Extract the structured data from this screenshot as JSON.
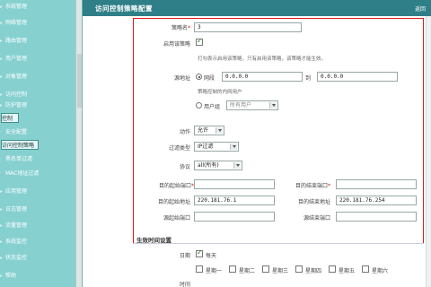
{
  "header": {
    "title": "访问控制策略配置",
    "back": "返回"
  },
  "sidebar": {
    "items": [
      {
        "label": "系统管理"
      },
      {
        "label": "网络管理"
      },
      {
        "label": "路由管理"
      },
      {
        "label": "用户管理"
      },
      {
        "label": "对象管理"
      },
      {
        "label": "访问控制"
      },
      {
        "label": "防护管理"
      },
      {
        "label": "控制"
      },
      {
        "label": "安全配置"
      },
      {
        "label": "访问控制策略"
      },
      {
        "label": "黑名单过滤"
      },
      {
        "label": "MAC地址过滤"
      },
      {
        "label": "应用管理"
      },
      {
        "label": "日志管理"
      },
      {
        "label": "流量管理"
      },
      {
        "label": "系统监控"
      },
      {
        "label": "状态监控"
      },
      {
        "label": "帮助"
      }
    ]
  },
  "form": {
    "policy_name_label": "策略名",
    "policy_name_value": "3",
    "enable_label": "启用该策略",
    "enable_hint": "打勾表示启用该策略，只有启用该策略，该策略才能生效。",
    "src_addr_label": "源地址",
    "src_range_label": "网段",
    "src_start": "0.0.0.0",
    "src_to": "到",
    "src_end": "0.0.0.0",
    "src_hint": "策略控制的内网用户",
    "user_group_label": "用户组",
    "user_group_value": "所有用户",
    "action_label": "动作",
    "action_value": "允许",
    "filter_type_label": "过滤类型",
    "filter_type_value": "IP过滤",
    "protocol_label": "协议",
    "protocol_value": "all(所有)",
    "src_port_start_label": "目的起始端口",
    "src_port_start_value": "",
    "dst_port_end_label": "目的结束端口",
    "dst_port_end_value": "",
    "dst_start_addr_label": "目的起始地址",
    "dst_start_addr_value": "220.181.76.1",
    "dst_end_addr_label": "目的结束地址",
    "dst_end_addr_value": "220.181.76.254",
    "sport_start_label": "源起始端口",
    "sport_start_value": "",
    "sport_end_label": "源结束端口",
    "sport_end_value": ""
  },
  "schedule": {
    "section_title": "生效时间设置",
    "date_label": "日期",
    "everyday_label": "每天",
    "days": [
      "星期一",
      "星期二",
      "星期三",
      "星期四",
      "星期五",
      "星期六"
    ],
    "time_label": "时间"
  },
  "colors": {
    "sidebar": "#86d0d0",
    "header": "#2f7f88",
    "highlight": "#e3171c"
  }
}
